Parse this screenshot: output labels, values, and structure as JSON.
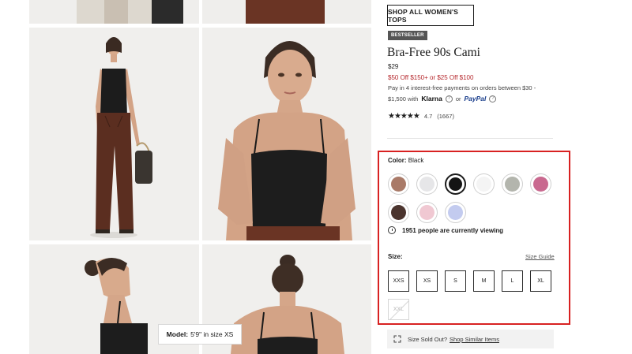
{
  "gallery": {
    "model_tag_label": "Model:",
    "model_tag_value": "5'9\" in size XS"
  },
  "product": {
    "shop_all_label": "SHOP ALL WOMEN'S TOPS",
    "badge": "BESTSELLER",
    "title": "Bra-Free 90s Cami",
    "price": "$29",
    "promo": "$50 Off $150+ or $25 Off $100",
    "pay_line1": "Pay in 4 interest-free payments on orders between $30 -",
    "pay_range_end": "$1,500 with",
    "klarna": "Klarna",
    "or": "or",
    "paypal": "PayPal",
    "info_glyph": "?",
    "stars": "★★★★★",
    "rating": "4.7",
    "reviews": "(1667)"
  },
  "color": {
    "label": "Color:",
    "selected": "Black",
    "swatches": [
      {
        "hex": "#a97a68"
      },
      {
        "hex": "#e6e6e8"
      },
      {
        "hex": "#141414"
      },
      {
        "hex": "#f4f4f4"
      },
      {
        "hex": "#b3b5ad"
      },
      {
        "hex": "#c9698f"
      },
      {
        "hex": "#4b342e"
      },
      {
        "hex": "#f0c8d2"
      },
      {
        "hex": "#c3cbef"
      }
    ],
    "viewing": "1951 people are currently viewing"
  },
  "size": {
    "label": "Size:",
    "guide": "Size Guide",
    "options": [
      "XXS",
      "XS",
      "S",
      "M",
      "L",
      "XL",
      "XXL"
    ]
  },
  "sold_out": {
    "text": "Size Sold Out?",
    "link": "Shop Similar Items"
  }
}
